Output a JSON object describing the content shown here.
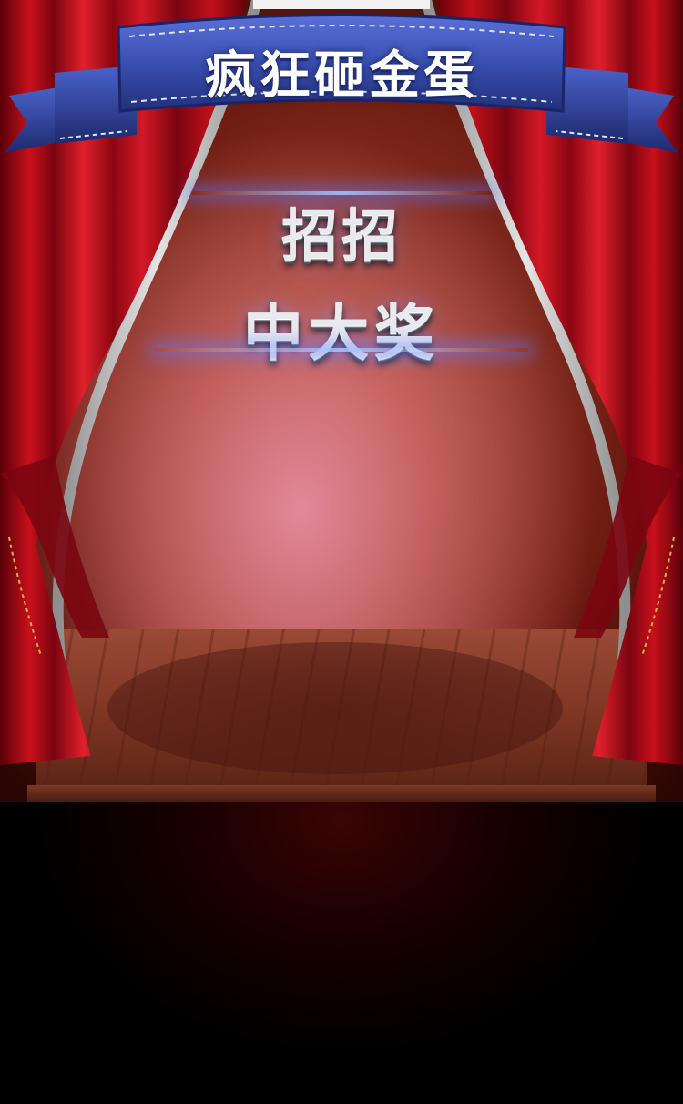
{
  "ribbon": {
    "title": "疯狂砸金蛋",
    "color": "#3a4fb0"
  },
  "slogan": {
    "line1": "招招",
    "line2": "中大奖"
  },
  "stage": {
    "curtain_color": "#b0101a",
    "frame_color": "#c8c8c8"
  }
}
